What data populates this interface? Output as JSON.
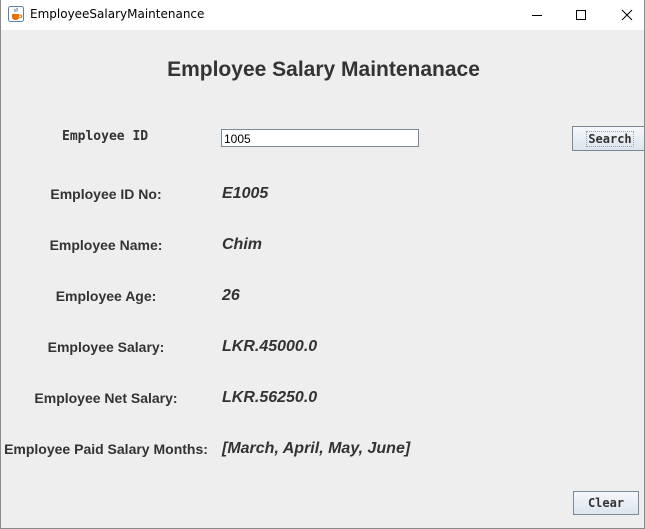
{
  "window": {
    "title": "EmployeeSalaryMaintenance",
    "icon": "java-cup-icon"
  },
  "form": {
    "heading": "Employee Salary Maintenanace",
    "employee_id_label": "Employee ID",
    "employee_id_value": "1005",
    "search_label": "Search",
    "clear_label": "Clear"
  },
  "details": [
    {
      "label": "Employee ID No:",
      "value": "E1005"
    },
    {
      "label": "Employee Name:",
      "value": "Chim"
    },
    {
      "label": "Employee Age:",
      "value": "26"
    },
    {
      "label": "Employee Salary:",
      "value": "LKR.45000.0"
    },
    {
      "label": "Employee Net Salary:",
      "value": "LKR.56250.0"
    },
    {
      "label": "Employee Paid Salary Months:",
      "value": "[March, April, May, June]"
    }
  ]
}
